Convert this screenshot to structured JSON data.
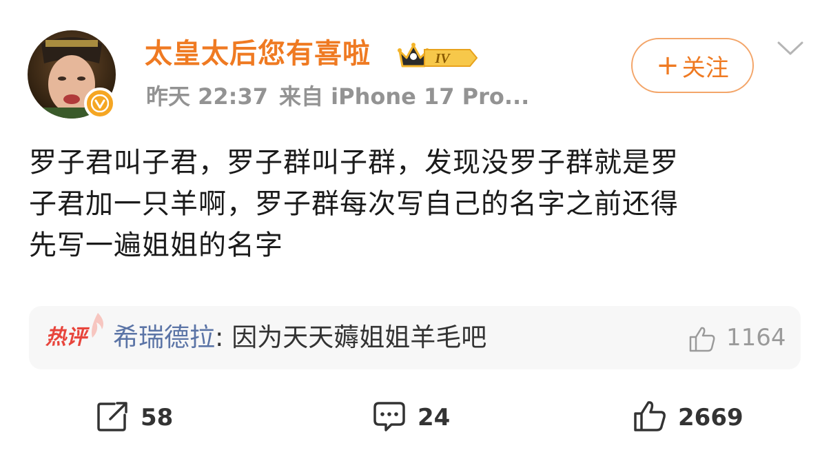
{
  "post": {
    "username": "太皇太后您有喜啦",
    "level": "IV",
    "time": "昨天 22:37",
    "source": "来自 iPhone 17 Pro...",
    "follow_label": "关注",
    "content_lines": [
      "罗子君叫子君，罗子群叫子群，发现没罗子群就是罗",
      "子君加一只羊啊，罗子群每次写自己的名字之前还得",
      "先写一遍姐姐的名字"
    ]
  },
  "hot_comment": {
    "tag": "热评",
    "user": "希瑞德拉",
    "separator": ": ",
    "text": "因为天天薅姐姐羊毛吧",
    "likes": "1164"
  },
  "actions": {
    "repost_count": "58",
    "comment_count": "24",
    "like_count": "2669"
  },
  "colors": {
    "accent_orange": "#ef7a22",
    "hot_red": "#e8453c",
    "link_blue": "#5b74a6",
    "meta_gray": "#939393"
  },
  "icons": [
    "chevron-down-icon",
    "plus-icon",
    "crown-icon",
    "verified-v-icon",
    "flame-icon",
    "thumbs-up-icon",
    "share-icon",
    "comment-icon"
  ]
}
